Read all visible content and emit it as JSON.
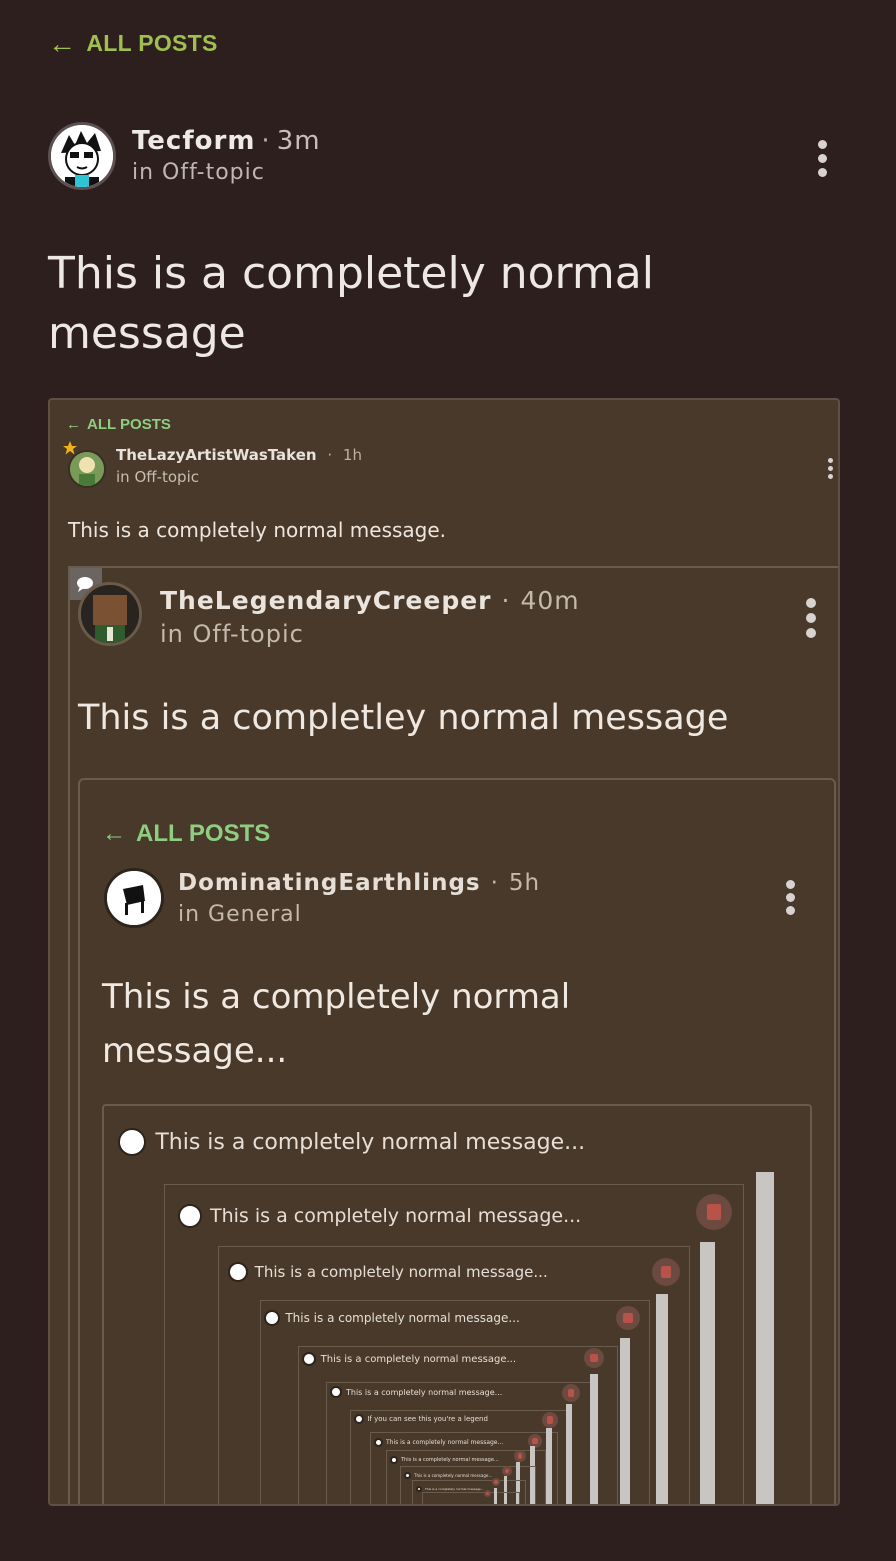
{
  "header": {
    "back_label": "ALL POSTS"
  },
  "post": {
    "author": "Tecform",
    "time": "3m",
    "category": "in Off-topic",
    "title": "This is a completely normal message"
  },
  "screenshot": {
    "back_label": "ALL POSTS",
    "author": "TheLazyArtistWasTaken",
    "time": "1h",
    "category": "in Off-topic",
    "message": "This is a completely normal message.",
    "nested": {
      "author": "TheLegendaryCreeper",
      "time": "40m",
      "category": "in Off-topic",
      "message": "This is a completley normal message",
      "nested": {
        "back_label": "ALL POSTS",
        "author": "DominatingEarthlings",
        "time": "5h",
        "category": "in General",
        "message": "This is a completely normal message...",
        "recursive_rows": [
          "This is a completely normal message...",
          "This is a completely normal message...",
          "This is a completely normal message...",
          "This is a completely normal message...",
          "This is a completely normal message...",
          "This is a completely normal message...",
          "If you can see this you're a legend",
          "This is a completely normal message...",
          "This is a completely normal message...",
          "This is a completely normal message...",
          "This is a completely normal message..."
        ]
      }
    }
  },
  "colors": {
    "background": "#2e1f1f",
    "accent_green": "#9fc04f",
    "nested_green": "#8fce81",
    "screenshot_bg": "#48392b"
  }
}
